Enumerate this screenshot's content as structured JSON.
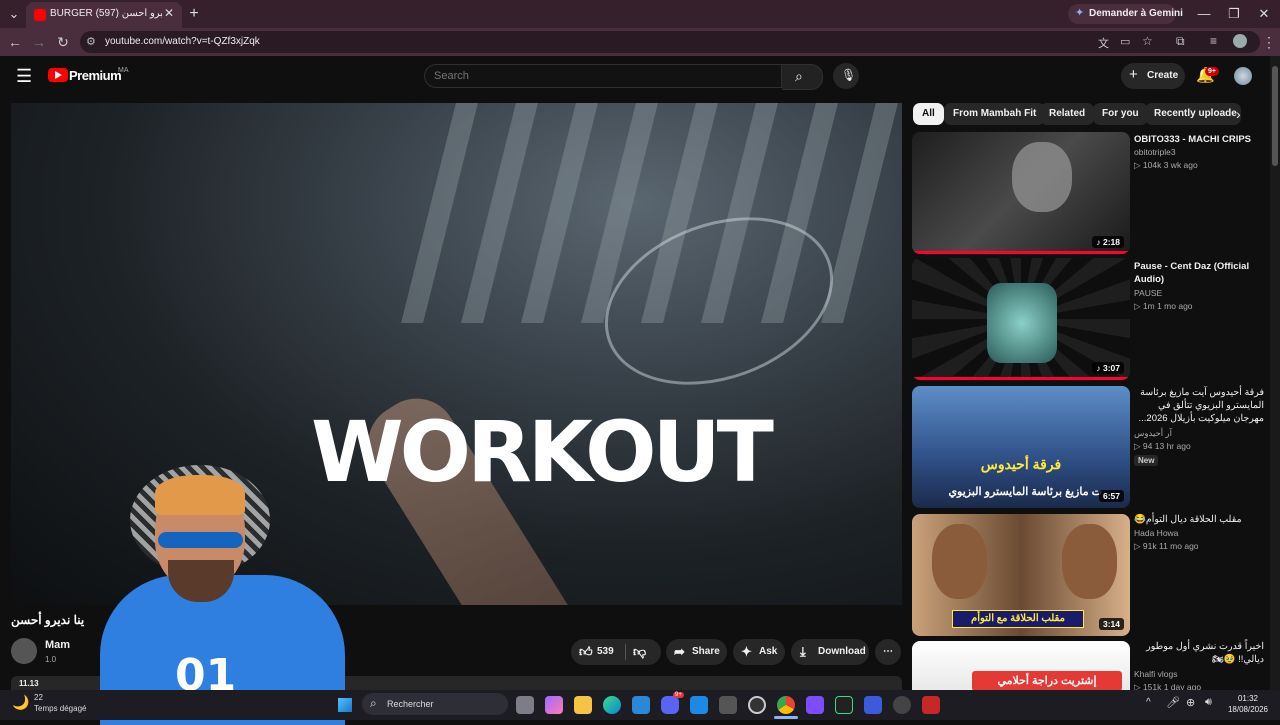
{
  "browser": {
    "tab_title": "BURGER جربنا نديرو أحسن (597)",
    "gemini_label": "Demander à Gemini",
    "url": "youtube.com/watch?v=t-QZf3xjZqk"
  },
  "youtube": {
    "logo_text": "Premium",
    "region": "MA",
    "search_placeholder": "Search",
    "create_label": "Create",
    "notif_count": "9+"
  },
  "video": {
    "overlay_text": "WORKOUT",
    "title_partial": "ينا نديرو أحسن",
    "channel_partial": "Mam",
    "subs_partial": "1.0",
    "views_partial": "11.13"
  },
  "actions": {
    "likes": "539",
    "share": "Share",
    "ask": "Ask",
    "download": "Download"
  },
  "chips": [
    "All",
    "From Mambah Fit",
    "Related",
    "For you",
    "Recently uploade"
  ],
  "recommendations": [
    {
      "title": "OBITO333 - MACHI CRIPS",
      "channel": "obitotriple3",
      "views": "104k",
      "age": "3 wk ago",
      "duration": "2:18",
      "is_audio": true
    },
    {
      "title": "Pause - Cent Daz (Official Audio)",
      "channel": "PAUSE",
      "views": "1m",
      "age": "1 mo ago",
      "duration": "3:07",
      "is_audio": true
    },
    {
      "title": "فرقة أحيدوس آيت مازيغ برئاسة المايسترو البزيوي تتألق في مهرجان ميلوكيت بأزيلال 2026...",
      "channel": "آر أحيدوس",
      "views": "94",
      "age": "13 hr ago",
      "duration": "6:57",
      "badge": "New",
      "thumb_text": "فرقة أحيدوس",
      "thumb_text2": "ت مازيغ برئاسة المايسترو البزيوي"
    },
    {
      "title": "مقلب الحلاقة ديال التوأم😂",
      "channel": "Hada Howa",
      "views": "91k",
      "age": "11 mo ago",
      "duration": "3:14",
      "thumb_text": "مقلب الحلاقة مع التوأم"
    },
    {
      "title": "اخيراً قدرت نشري أول موطور ديالي!! 🥹🏍",
      "channel": "Khalfi vlogs",
      "views": "151k",
      "age": "1 day ago",
      "thumb_text": "إشتريت دراجة أحلامي"
    }
  ],
  "taskbar": {
    "weather_temp": "22",
    "weather_desc": "Temps dégagé",
    "search_label": "Rechercher",
    "time": "01:32",
    "date": "18/08/2026",
    "badge_count": "9+"
  }
}
